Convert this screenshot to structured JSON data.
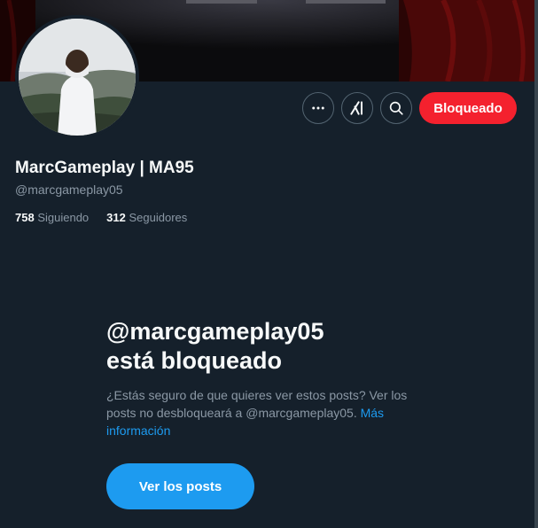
{
  "profile": {
    "display_name": "MarcGameplay | MA95",
    "handle": "@marcgameplay05",
    "following_count": "758",
    "following_label": "Siguiendo",
    "followers_count": "312",
    "followers_label": "Seguidores"
  },
  "actions": {
    "more_icon": "more-horizontal-icon",
    "grok_icon": "grok-icon",
    "search_icon": "search-icon",
    "blocked_label": "Bloqueado"
  },
  "blocked_notice": {
    "title_line1": "@marcgameplay05",
    "title_line2": "está bloqueado",
    "description": "¿Estás seguro de que quieres ver estos posts? Ver los posts no desbloqueará a @marcgameplay05.",
    "link_text": "Más información",
    "view_posts_label": "Ver los posts"
  },
  "colors": {
    "background": "#15202b",
    "blocked_button": "#f4212e",
    "primary_button": "#1d9bf0",
    "link": "#1d9bf0",
    "text_primary": "#f7f9f9",
    "text_secondary": "#8b98a5"
  }
}
